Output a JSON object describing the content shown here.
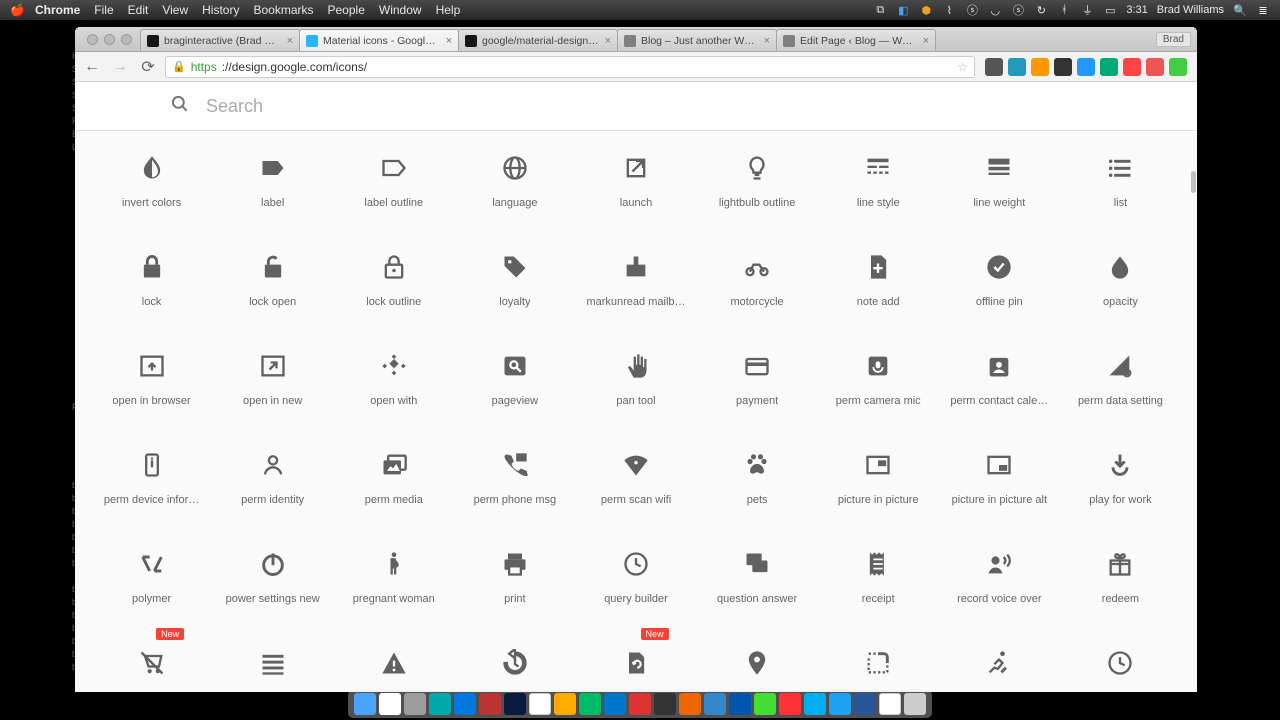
{
  "menubar": {
    "app": "Chrome",
    "items": [
      "File",
      "Edit",
      "View",
      "History",
      "Bookmarks",
      "People",
      "Window",
      "Help"
    ],
    "clock": "3:31",
    "user": "Brad Williams"
  },
  "tabs": [
    {
      "label": "braginteractive (Brad Will…",
      "icon": "#181717"
    },
    {
      "label": "Material icons - Google De",
      "icon": "#29b6f6",
      "active": true
    },
    {
      "label": "google/material-design-ic…",
      "icon": "#181717"
    },
    {
      "label": "Blog – Just another WordP",
      "icon": "#808080"
    },
    {
      "label": "Edit Page ‹ Blog — WordPr",
      "icon": "#808080"
    }
  ],
  "profile": "Brad",
  "url": {
    "proto": "https",
    "rest": "://design.google.com/icons/"
  },
  "search": {
    "placeholder": "Search"
  },
  "icons": [
    [
      {
        "n": "invert colors",
        "svg": "invert"
      },
      {
        "n": "label",
        "svg": "label"
      },
      {
        "n": "label outline",
        "svg": "label-o"
      },
      {
        "n": "language",
        "svg": "lang"
      },
      {
        "n": "launch",
        "svg": "launch"
      },
      {
        "n": "lightbulb outline",
        "svg": "bulb"
      },
      {
        "n": "line style",
        "svg": "lstyle"
      },
      {
        "n": "line weight",
        "svg": "lweight"
      },
      {
        "n": "list",
        "svg": "list"
      }
    ],
    [
      {
        "n": "lock",
        "svg": "lock"
      },
      {
        "n": "lock open",
        "svg": "lock-o"
      },
      {
        "n": "lock outline",
        "svg": "lock-ol"
      },
      {
        "n": "loyalty",
        "svg": "tag"
      },
      {
        "n": "markunread mailb…",
        "svg": "mailbox"
      },
      {
        "n": "motorcycle",
        "svg": "moto"
      },
      {
        "n": "note add",
        "svg": "noteadd"
      },
      {
        "n": "offline pin",
        "svg": "offpin"
      },
      {
        "n": "opacity",
        "svg": "opacity"
      }
    ],
    [
      {
        "n": "open in browser",
        "svg": "oib"
      },
      {
        "n": "open in new",
        "svg": "oin"
      },
      {
        "n": "open with",
        "svg": "owith"
      },
      {
        "n": "pageview",
        "svg": "pview"
      },
      {
        "n": "pan tool",
        "svg": "pan"
      },
      {
        "n": "payment",
        "svg": "pay"
      },
      {
        "n": "perm camera mic",
        "svg": "pcm"
      },
      {
        "n": "perm contact cale…",
        "svg": "pcc"
      },
      {
        "n": "perm data setting",
        "svg": "pds"
      }
    ],
    [
      {
        "n": "perm device infor…",
        "svg": "pdi"
      },
      {
        "n": "perm identity",
        "svg": "pid"
      },
      {
        "n": "perm media",
        "svg": "pmd"
      },
      {
        "n": "perm phone msg",
        "svg": "ppm"
      },
      {
        "n": "perm scan wifi",
        "svg": "psw"
      },
      {
        "n": "pets",
        "svg": "pets"
      },
      {
        "n": "picture in picture",
        "svg": "pip"
      },
      {
        "n": "picture in picture alt",
        "svg": "pipa"
      },
      {
        "n": "play for work",
        "svg": "pfw"
      }
    ],
    [
      {
        "n": "polymer",
        "svg": "poly"
      },
      {
        "n": "power settings new",
        "svg": "power"
      },
      {
        "n": "pregnant woman",
        "svg": "preg"
      },
      {
        "n": "print",
        "svg": "print"
      },
      {
        "n": "query builder",
        "svg": "clock"
      },
      {
        "n": "question answer",
        "svg": "qa"
      },
      {
        "n": "receipt",
        "svg": "rcpt"
      },
      {
        "n": "record voice over",
        "svg": "rvo"
      },
      {
        "n": "redeem",
        "svg": "gift"
      }
    ],
    [
      {
        "n": "remove shopping …",
        "svg": "rsc",
        "new": true
      },
      {
        "n": "reorder",
        "svg": "reord"
      },
      {
        "n": "report problem",
        "svg": "warn"
      },
      {
        "n": "restore",
        "svg": "rest"
      },
      {
        "n": "restore page",
        "svg": "restp",
        "new": true
      },
      {
        "n": "room",
        "svg": "pin"
      },
      {
        "n": "rounded corner",
        "svg": "rc"
      },
      {
        "n": "rowing",
        "svg": "row"
      },
      {
        "n": "schedule",
        "svg": "clock"
      }
    ]
  ],
  "newbadge": "New",
  "ext_colors": [
    "#555",
    "#2b8",
    "#f90",
    "#333",
    "#29f",
    "#0a7",
    "#f44",
    "#e55",
    "#4c4"
  ]
}
